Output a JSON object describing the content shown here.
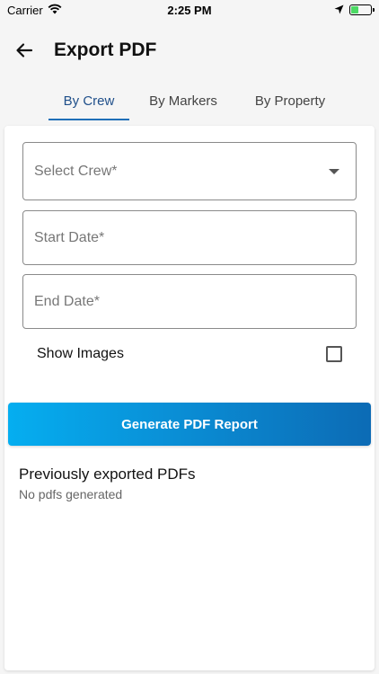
{
  "status_bar": {
    "carrier": "Carrier",
    "time": "2:25 PM"
  },
  "header": {
    "title": "Export PDF"
  },
  "tabs": [
    {
      "label": "By Crew",
      "active": true
    },
    {
      "label": "By Markers",
      "active": false
    },
    {
      "label": "By Property",
      "active": false
    }
  ],
  "form": {
    "crew_placeholder": "Select Crew*",
    "start_date_placeholder": "Start Date*",
    "end_date_placeholder": "End Date*",
    "show_images_label": "Show Images",
    "show_images_checked": false,
    "generate_label": "Generate PDF Report"
  },
  "previous": {
    "title": "Previously exported PDFs",
    "empty_text": "No pdfs generated"
  },
  "colors": {
    "accent": "#1f6fb8",
    "button_gradient_start": "#05aef0",
    "button_gradient_end": "#0c6bb5",
    "battery": "#4cd964"
  }
}
